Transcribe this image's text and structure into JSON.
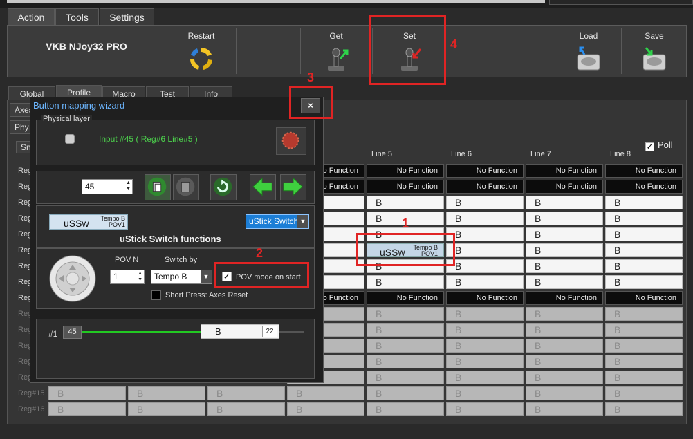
{
  "menu_tabs": [
    "Action",
    "Tools",
    "Settings"
  ],
  "ribbon": {
    "device": "VKB NJoy32 PRO",
    "restart": "Restart",
    "get": "Get",
    "set": "Set",
    "load": "Load",
    "save": "Save"
  },
  "profile_tabs": [
    "Global",
    "Profile",
    "Macro",
    "Test",
    "Info"
  ],
  "sub_tabs": [
    "Axes",
    "Phy",
    "Sn"
  ],
  "grid": {
    "poll_label": "Poll",
    "columns": [
      "Line 5",
      "Line 6",
      "Line 7",
      "Line 8"
    ],
    "rows": [
      "Reg",
      "Reg",
      "Reg",
      "Reg",
      "Reg",
      "Reg",
      "Reg",
      "Reg",
      "Reg",
      "Reg",
      "Reg",
      "Reg",
      "Reg",
      "Reg",
      "Reg#15",
      "Reg#16"
    ],
    "no_function": "No Function",
    "b": "B",
    "ussw": {
      "label": "uSSw",
      "tag_top": "Tempo B",
      "tag_bottom": "POV1"
    }
  },
  "wizard": {
    "title": "Button mapping wizard",
    "close": "×",
    "physical_layer": "Physical layer",
    "input_info": "Input #45  ( Reg#6   Line#5 )",
    "number": "45",
    "ussw": {
      "label": "uSSw",
      "tag_top": "Tempo B",
      "tag_bottom": "POV1"
    },
    "function_select": "uStick Switch",
    "heading": "uStick Switch functions",
    "pov_n_label": "POV N",
    "pov_n_value": "1",
    "switch_by_label": "Switch by",
    "switch_by_value": "Tempo B",
    "pov_mode_label": "POV mode on start",
    "short_press_label": "Short Press: Axes Reset",
    "slider_index": "#1",
    "slider_value": "45",
    "slider_button": "B",
    "slider_end": "22",
    "slider_level": 0.66
  },
  "annotations": [
    "1",
    "2",
    "3",
    "4"
  ],
  "colors": {
    "accent_red": "#e02424",
    "green": "#3fcf3f",
    "title_blue": "#6cb6ff"
  }
}
